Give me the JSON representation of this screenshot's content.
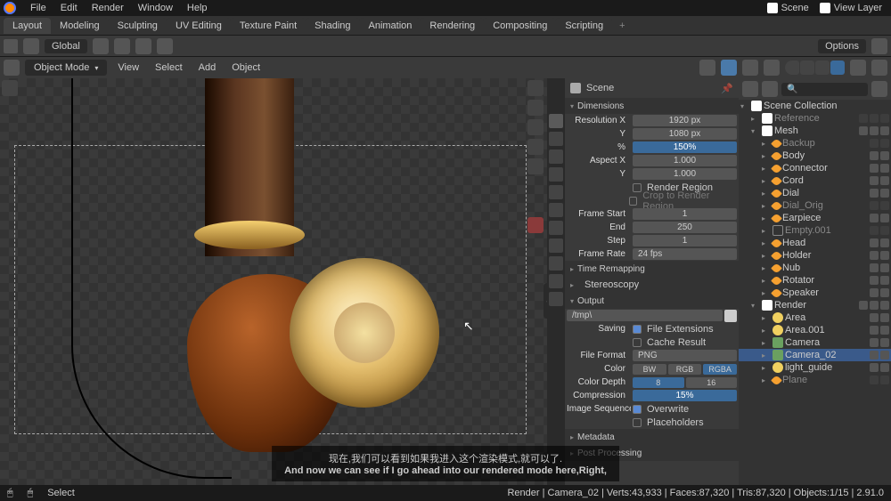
{
  "menu": {
    "file": "File",
    "edit": "Edit",
    "render": "Render",
    "window": "Window",
    "help": "Help"
  },
  "right_header": {
    "scene": "Scene",
    "viewlayer": "View Layer"
  },
  "tabs": [
    "Layout",
    "Modeling",
    "Sculpting",
    "UV Editing",
    "Texture Paint",
    "Shading",
    "Animation",
    "Rendering",
    "Compositing",
    "Scripting"
  ],
  "viewheader": {
    "orientation": "Global",
    "options": "Options"
  },
  "viewsub": {
    "mode": "Object Mode",
    "view": "View",
    "select": "Select",
    "add": "Add",
    "object": "Object"
  },
  "props": {
    "scene_label": "Scene",
    "dimensions": "Dimensions",
    "res_x_lbl": "Resolution X",
    "res_x": "1920 px",
    "res_y_lbl": "Y",
    "res_y": "1080 px",
    "pct_lbl": "%",
    "pct": "150%",
    "aspect_x_lbl": "Aspect X",
    "aspect_x": "1.000",
    "aspect_y_lbl": "Y",
    "aspect_y": "1.000",
    "render_region": "Render Region",
    "crop_region": "Crop to Render Region",
    "frame_start_lbl": "Frame Start",
    "frame_start": "1",
    "frame_end_lbl": "End",
    "frame_end": "250",
    "frame_step_lbl": "Step",
    "frame_step": "1",
    "frame_rate_lbl": "Frame Rate",
    "frame_rate": "24 fps",
    "time_remapping": "Time Remapping",
    "stereoscopy": "Stereoscopy",
    "output": "Output",
    "output_path": "/tmp\\",
    "saving_lbl": "Saving",
    "file_ext": "File Extensions",
    "cache_result": "Cache Result",
    "file_format_lbl": "File Format",
    "file_format": "PNG",
    "color_lbl": "Color",
    "color_bw": "BW",
    "color_rgb": "RGB",
    "color_rgba": "RGBA",
    "depth_lbl": "Color Depth",
    "depth_8": "8",
    "depth_16": "16",
    "compression_lbl": "Compression",
    "compression": "15%",
    "img_seq_lbl": "Image Sequence",
    "overwrite": "Overwrite",
    "placeholders": "Placeholders",
    "metadata": "Metadata",
    "post_processing": "Post Processing"
  },
  "outliner": {
    "collection": "Scene Collection",
    "reference": "Reference",
    "mesh": "Mesh",
    "items": [
      "Backup",
      "Body",
      "Connector",
      "Cord",
      "Dial",
      "Dial_Orig",
      "Earpiece",
      "Empty.001",
      "Head",
      "Holder",
      "Nub",
      "Rotator",
      "Speaker"
    ],
    "render": "Render",
    "render_items": [
      "Area",
      "Area.001",
      "Camera",
      "Camera_02",
      "light_guide",
      "Plane"
    ]
  },
  "subtitle": {
    "cn": "现在,我们可以看到如果我进入这个渲染模式,就可以了.",
    "en": "And now we can see if I go ahead into our rendered mode here,Right,"
  },
  "status": {
    "select": "Select",
    "info": "Render | Camera_02 | Verts:43,933 | Faces:87,320 | Tris:87,320 | Objects:1/15 | 2.91.0"
  }
}
